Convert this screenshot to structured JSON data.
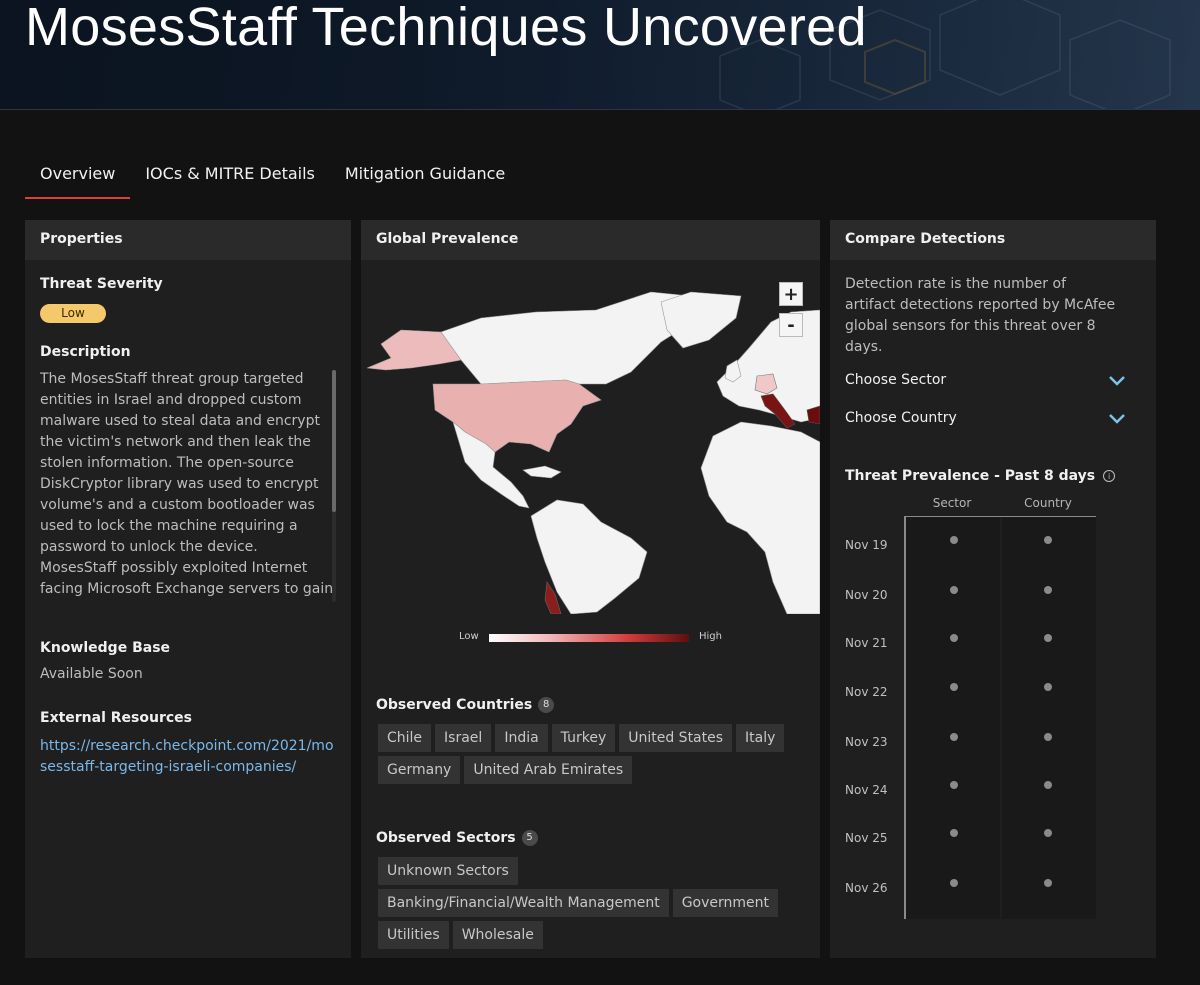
{
  "page": {
    "title": "MosesStaff Techniques Uncovered"
  },
  "tabs": [
    {
      "label": "Overview",
      "active": true
    },
    {
      "label": "IOCs & MITRE Details",
      "active": false
    },
    {
      "label": "Mitigation Guidance",
      "active": false
    }
  ],
  "properties": {
    "header": "Properties",
    "threat_severity_label": "Threat Severity",
    "threat_severity_value": "Low",
    "description_label": "Description",
    "description": "The MosesStaff threat group targeted entities in Israel and dropped custom malware used to steal data and encrypt the victim's network and then leak the stolen information. The open-source DiskCryptor library was used to encrypt volume's and a custom bootloader was used to lock the machine requiring a password to unlock the device. MosesStaff possibly exploited Internet facing Microsoft Exchange servers to gain an initial foothold into the network.",
    "knowledge_base_label": "Knowledge Base",
    "knowledge_base_value": "Available Soon",
    "external_resources_label": "External Resources",
    "external_link": "https://research.checkpoint.com/2021/mosesstaff-targeting-israeli-companies/"
  },
  "global_prevalence": {
    "header": "Global Prevalence",
    "zoom_in": "+",
    "zoom_out": "-",
    "legend_low": "Low",
    "legend_high": "High",
    "observed_countries_label": "Observed Countries",
    "observed_countries_count": "8",
    "countries": [
      "Chile",
      "Israel",
      "India",
      "Turkey",
      "United States",
      "Italy",
      "Germany",
      "United Arab Emirates"
    ],
    "observed_sectors_label": "Observed Sectors",
    "observed_sectors_count": "5",
    "sectors": [
      "Unknown Sectors",
      "Banking/Financial/Wealth Management",
      "Government",
      "Utilities",
      "Wholesale"
    ],
    "colors": {
      "low": "#ffffff",
      "mid": "#e8a8a8",
      "high": "#6b0d0d",
      "land": "#f3f3f3"
    }
  },
  "compare": {
    "header": "Compare Detections",
    "description": "Detection rate is the number of artifact detections reported by McAfee global sensors for this threat over 8 days.",
    "choose_sector": "Choose Sector",
    "choose_country": "Choose Country",
    "threat_prevalence_label": "Threat Prevalence - Past 8 days",
    "col_sector": "Sector",
    "col_country": "Country",
    "dates": [
      "Nov 19",
      "Nov 20",
      "Nov 21",
      "Nov 22",
      "Nov 23",
      "Nov 24",
      "Nov 25",
      "Nov 26"
    ]
  },
  "colors": {
    "accent_tab": "#d9413a",
    "severity_low": "#f5c96b",
    "link": "#7bb8e8",
    "chevron": "#7ec3ea"
  }
}
